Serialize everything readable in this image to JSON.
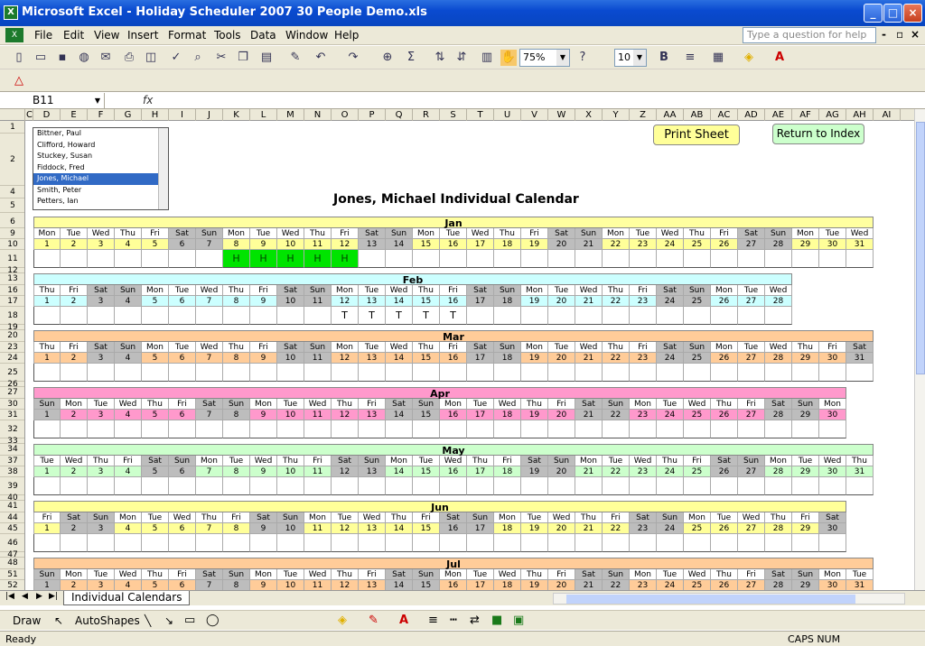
{
  "app": {
    "title": "Microsoft Excel - Holiday Scheduler 2007 30 People Demo.xls"
  },
  "menu": [
    "File",
    "Edit",
    "View",
    "Insert",
    "Format",
    "Tools",
    "Data",
    "Window",
    "Help"
  ],
  "ask_placeholder": "Type a question for help",
  "toolbar": {
    "zoom": "75%",
    "font_size": "10"
  },
  "formula_bar": {
    "name_box": "B11",
    "fx": "fx"
  },
  "columns": [
    "C",
    "D",
    "E",
    "F",
    "G",
    "H",
    "I",
    "J",
    "K",
    "L",
    "M",
    "N",
    "O",
    "P",
    "Q",
    "R",
    "S",
    "T",
    "U",
    "V",
    "W",
    "X",
    "Y",
    "Z",
    "AA",
    "AB",
    "AC",
    "AD",
    "AE",
    "AF",
    "AG",
    "AH",
    "AI"
  ],
  "rows": [
    "1",
    "2",
    "4",
    "5",
    "6",
    "9",
    "10",
    "11",
    "12",
    "13",
    "16",
    "17",
    "18",
    "19",
    "20",
    "23",
    "24",
    "25",
    "26",
    "27",
    "30",
    "31",
    "32",
    "33",
    "34",
    "37",
    "38",
    "39",
    "40",
    "41",
    "44",
    "45",
    "46",
    "47",
    "48",
    "51",
    "52"
  ],
  "listbox": {
    "items": [
      "Bittner, Paul",
      "Clifford, Howard",
      "Stuckey, Susan",
      "Fiddock, Fred",
      "Jones, Michael",
      "Smith, Peter",
      "Petters, Ian"
    ],
    "selected": 4
  },
  "buttons": {
    "print": "Print Sheet",
    "index": "Return to Index"
  },
  "calendar_title": "Jones, Michael Individual Calendar",
  "colors": {
    "weekend": "#bdbdbd",
    "holiday": "#00e400"
  },
  "months": [
    {
      "name": "Jan",
      "days": 31,
      "start": 0,
      "color": "#ffffa0",
      "daycolor": "#ffff99",
      "entries": {
        "8": "H",
        "9": "H",
        "10": "H",
        "11": "H",
        "12": "H"
      }
    },
    {
      "name": "Feb",
      "days": 28,
      "start": 3,
      "color": "#ccffff",
      "daycolor": "#ccffff",
      "entries": {
        "12": "T",
        "13": "T",
        "14": "T",
        "15": "T",
        "16": "T"
      }
    },
    {
      "name": "Mar",
      "days": 31,
      "start": 3,
      "color": "#ffcc99",
      "daycolor": "#ffcc99",
      "entries": {}
    },
    {
      "name": "Apr",
      "days": 30,
      "start": 6,
      "color": "#ff99cc",
      "daycolor": "#ff99cc",
      "entries": {}
    },
    {
      "name": "May",
      "days": 31,
      "start": 1,
      "color": "#ccffcc",
      "daycolor": "#ccffcc",
      "entries": {}
    },
    {
      "name": "Jun",
      "days": 30,
      "start": 4,
      "color": "#ffff99",
      "daycolor": "#ffff99",
      "entries": {}
    },
    {
      "name": "Jul",
      "days": 31,
      "start": 6,
      "color": "#ffcc99",
      "daycolor": "#ffcc99",
      "entries": {}
    }
  ],
  "weekdays": [
    "Mon",
    "Tue",
    "Wed",
    "Thu",
    "Fri",
    "Sat",
    "Sun"
  ],
  "sheet_tab": "Individual Calendars",
  "drawbar": {
    "draw": "Draw",
    "autoshapes": "AutoShapes"
  },
  "status": {
    "left": "Ready",
    "right": "CAPS NUM"
  }
}
